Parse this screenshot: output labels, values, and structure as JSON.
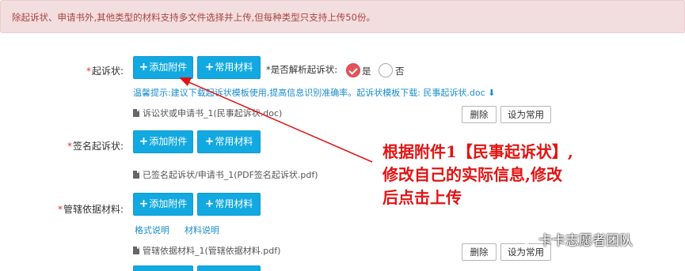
{
  "notice": "除起诉状、申请书外,其他类型的材料支持多文件选择并上传,但每种类型只支持上传50份。",
  "common": {
    "add_attachment": "添加附件",
    "common_material": "常用材料",
    "delete": "删除",
    "set_common": "设为常用"
  },
  "complaint": {
    "label": "起诉状:",
    "parse_question": "*是否解析起诉状:",
    "parse_yes": "是",
    "parse_no": "否",
    "tip": "温馨提示:建议下载起诉状模板使用,提高信息识别准确率。起诉状模板下载:",
    "template_link": "民事起诉状.doc",
    "file_name": "诉讼状或申请书_1(民事起诉状.doc)"
  },
  "signed": {
    "label": "签名起诉状:",
    "file_name": "已签名起诉状/申请书_1(PDF签名起诉状.pdf)"
  },
  "jurisdiction": {
    "label": "管辖依据材料:",
    "format_link": "格式说明",
    "material_link": "材料说明",
    "file_name": "管辖依据材料_1(管辖依据材料.pdf)"
  },
  "annotation": {
    "line1": "根据附件1【民事起诉状】,",
    "line2": "修改自己的实际信息,修改",
    "line3": "后点击上传"
  },
  "watermark": "卡卡志愿者团队",
  "colors": {
    "primary": "#12a9e1",
    "annotation": "#e01414",
    "notice_bg": "#f2dede",
    "link": "#1a8ccf"
  }
}
